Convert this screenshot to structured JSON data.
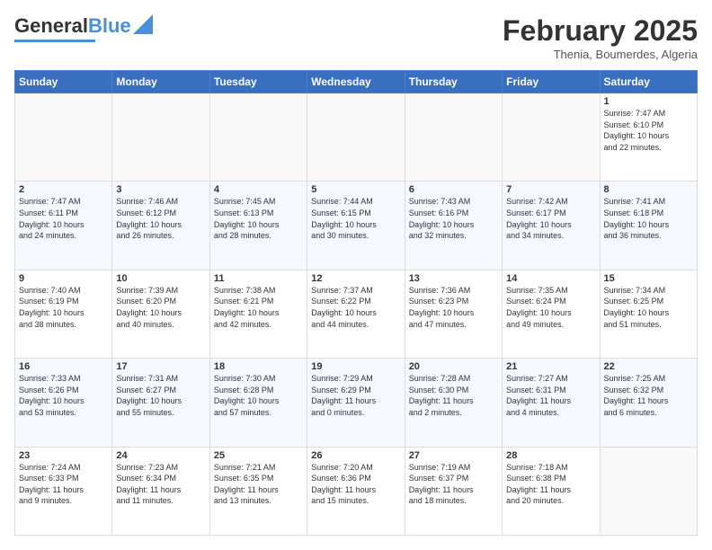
{
  "header": {
    "logo_general": "General",
    "logo_blue": "Blue",
    "month_title": "February 2025",
    "subtitle": "Thenia, Boumerdes, Algeria"
  },
  "days_of_week": [
    "Sunday",
    "Monday",
    "Tuesday",
    "Wednesday",
    "Thursday",
    "Friday",
    "Saturday"
  ],
  "weeks": [
    [
      {
        "day": "",
        "info": ""
      },
      {
        "day": "",
        "info": ""
      },
      {
        "day": "",
        "info": ""
      },
      {
        "day": "",
        "info": ""
      },
      {
        "day": "",
        "info": ""
      },
      {
        "day": "",
        "info": ""
      },
      {
        "day": "1",
        "info": "Sunrise: 7:47 AM\nSunset: 6:10 PM\nDaylight: 10 hours\nand 22 minutes."
      }
    ],
    [
      {
        "day": "2",
        "info": "Sunrise: 7:47 AM\nSunset: 6:11 PM\nDaylight: 10 hours\nand 24 minutes."
      },
      {
        "day": "3",
        "info": "Sunrise: 7:46 AM\nSunset: 6:12 PM\nDaylight: 10 hours\nand 26 minutes."
      },
      {
        "day": "4",
        "info": "Sunrise: 7:45 AM\nSunset: 6:13 PM\nDaylight: 10 hours\nand 28 minutes."
      },
      {
        "day": "5",
        "info": "Sunrise: 7:44 AM\nSunset: 6:15 PM\nDaylight: 10 hours\nand 30 minutes."
      },
      {
        "day": "6",
        "info": "Sunrise: 7:43 AM\nSunset: 6:16 PM\nDaylight: 10 hours\nand 32 minutes."
      },
      {
        "day": "7",
        "info": "Sunrise: 7:42 AM\nSunset: 6:17 PM\nDaylight: 10 hours\nand 34 minutes."
      },
      {
        "day": "8",
        "info": "Sunrise: 7:41 AM\nSunset: 6:18 PM\nDaylight: 10 hours\nand 36 minutes."
      }
    ],
    [
      {
        "day": "9",
        "info": "Sunrise: 7:40 AM\nSunset: 6:19 PM\nDaylight: 10 hours\nand 38 minutes."
      },
      {
        "day": "10",
        "info": "Sunrise: 7:39 AM\nSunset: 6:20 PM\nDaylight: 10 hours\nand 40 minutes."
      },
      {
        "day": "11",
        "info": "Sunrise: 7:38 AM\nSunset: 6:21 PM\nDaylight: 10 hours\nand 42 minutes."
      },
      {
        "day": "12",
        "info": "Sunrise: 7:37 AM\nSunset: 6:22 PM\nDaylight: 10 hours\nand 44 minutes."
      },
      {
        "day": "13",
        "info": "Sunrise: 7:36 AM\nSunset: 6:23 PM\nDaylight: 10 hours\nand 47 minutes."
      },
      {
        "day": "14",
        "info": "Sunrise: 7:35 AM\nSunset: 6:24 PM\nDaylight: 10 hours\nand 49 minutes."
      },
      {
        "day": "15",
        "info": "Sunrise: 7:34 AM\nSunset: 6:25 PM\nDaylight: 10 hours\nand 51 minutes."
      }
    ],
    [
      {
        "day": "16",
        "info": "Sunrise: 7:33 AM\nSunset: 6:26 PM\nDaylight: 10 hours\nand 53 minutes."
      },
      {
        "day": "17",
        "info": "Sunrise: 7:31 AM\nSunset: 6:27 PM\nDaylight: 10 hours\nand 55 minutes."
      },
      {
        "day": "18",
        "info": "Sunrise: 7:30 AM\nSunset: 6:28 PM\nDaylight: 10 hours\nand 57 minutes."
      },
      {
        "day": "19",
        "info": "Sunrise: 7:29 AM\nSunset: 6:29 PM\nDaylight: 11 hours\nand 0 minutes."
      },
      {
        "day": "20",
        "info": "Sunrise: 7:28 AM\nSunset: 6:30 PM\nDaylight: 11 hours\nand 2 minutes."
      },
      {
        "day": "21",
        "info": "Sunrise: 7:27 AM\nSunset: 6:31 PM\nDaylight: 11 hours\nand 4 minutes."
      },
      {
        "day": "22",
        "info": "Sunrise: 7:25 AM\nSunset: 6:32 PM\nDaylight: 11 hours\nand 6 minutes."
      }
    ],
    [
      {
        "day": "23",
        "info": "Sunrise: 7:24 AM\nSunset: 6:33 PM\nDaylight: 11 hours\nand 9 minutes."
      },
      {
        "day": "24",
        "info": "Sunrise: 7:23 AM\nSunset: 6:34 PM\nDaylight: 11 hours\nand 11 minutes."
      },
      {
        "day": "25",
        "info": "Sunrise: 7:21 AM\nSunset: 6:35 PM\nDaylight: 11 hours\nand 13 minutes."
      },
      {
        "day": "26",
        "info": "Sunrise: 7:20 AM\nSunset: 6:36 PM\nDaylight: 11 hours\nand 15 minutes."
      },
      {
        "day": "27",
        "info": "Sunrise: 7:19 AM\nSunset: 6:37 PM\nDaylight: 11 hours\nand 18 minutes."
      },
      {
        "day": "28",
        "info": "Sunrise: 7:18 AM\nSunset: 6:38 PM\nDaylight: 11 hours\nand 20 minutes."
      },
      {
        "day": "",
        "info": ""
      }
    ]
  ]
}
